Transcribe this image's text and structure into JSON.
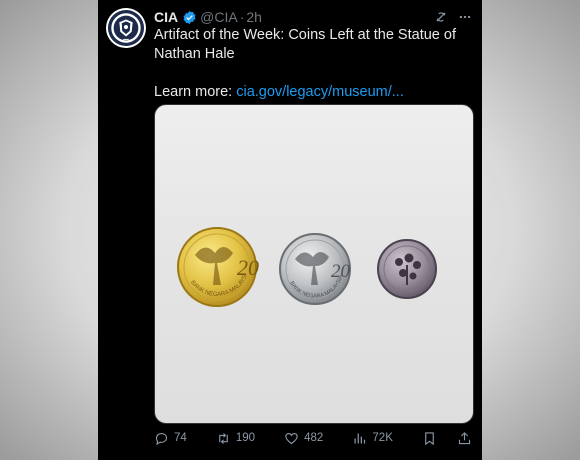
{
  "account": {
    "name": "CIA",
    "handle": "@CIA",
    "separator": "·",
    "time": "2h"
  },
  "post": {
    "line1": "Artifact of the Week: Coins Left at the Statue of",
    "line2": "Nathan Hale",
    "learn_more_prefix": "Learn more: ",
    "link_text": "cia.gov/legacy/museum/..."
  },
  "media": {
    "coin_inscriptions": [
      "20",
      "BANK NEGARA MALAYSIA"
    ]
  },
  "actions": {
    "replies": "74",
    "reposts": "190",
    "likes": "482",
    "views": "72K"
  },
  "colors": {
    "link": "#1d9bf0",
    "verified": "#1d9bf0",
    "background": "#000000",
    "muted": "#71767b"
  },
  "icons": [
    "cia-seal-icon",
    "verified-badge-icon",
    "grok-icon",
    "more-icon",
    "reply-icon",
    "repost-icon",
    "like-icon",
    "views-icon",
    "bookmark-icon",
    "share-icon"
  ]
}
